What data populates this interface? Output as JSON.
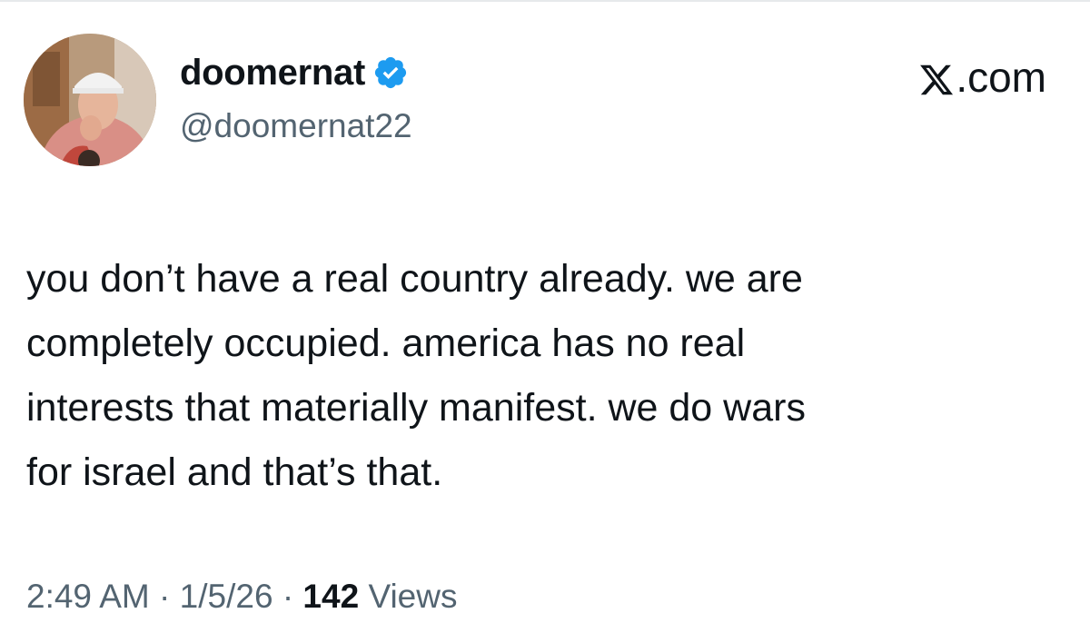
{
  "tweet": {
    "display_name": "doomernat",
    "handle": "@doomernat22",
    "verified": true,
    "site_label": ".com",
    "site_icon": "x-logo-icon",
    "text": "you don’t have a real country already. we are\ncompletely occupied. america has no real\ninterests that materially manifest. we do wars\nfor israel and that’s that.",
    "time": "2:49 AM",
    "separator": "·",
    "date": "1/5/26",
    "views_count": "142",
    "views_label": "Views"
  },
  "colors": {
    "text_primary": "#0f1419",
    "text_secondary": "#536471",
    "verified_blue": "#1d9bf0"
  }
}
